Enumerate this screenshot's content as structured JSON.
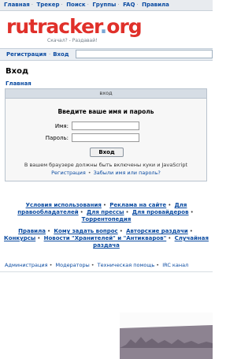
{
  "topnav": {
    "items": [
      "Главная",
      "Трекер",
      "Поиск",
      "Группы",
      "FAQ",
      "Правила"
    ]
  },
  "logo": {
    "part1": "ru",
    "part2": "tracker",
    "part3": ".",
    "part4": "org",
    "tagline": "Скачал? - Раздавай!"
  },
  "regbar": {
    "register": "Регистрация",
    "login": "Вход"
  },
  "page": {
    "title": "Вход",
    "breadcrumb": "Главная"
  },
  "login_box": {
    "header": "вход",
    "prompt": "Введите ваше имя и пароль",
    "name_label": "Имя:",
    "password_label": "Пароль:",
    "submit": "Вход",
    "notice": "В вашем браузере должны быть включены куки и JavaScript",
    "register_link": "Регистрация",
    "forgot_link": "Забыли имя или пароль?"
  },
  "footer_links": {
    "line1": [
      "Условия использования",
      "Реклама на сайте",
      "Для правообладателей",
      "Для прессы",
      "Для провайдеров",
      "Торрентопедия"
    ],
    "line2": [
      "Правила",
      "Кому задать вопрос",
      "Авторские раздачи",
      "Конкурсы",
      "Новости \"Хранителей\" и \"Антикваров\"",
      "Случайная раздача"
    ]
  },
  "bottom_links": [
    "Администрация",
    "Модераторы",
    "Техническая помощь",
    "IRC канал"
  ],
  "colors": {
    "link": "#0B4BA1",
    "logo_red": "#E0302A",
    "logo_blue": "#7aa7d6",
    "header_bg": "#D6DDE5"
  }
}
